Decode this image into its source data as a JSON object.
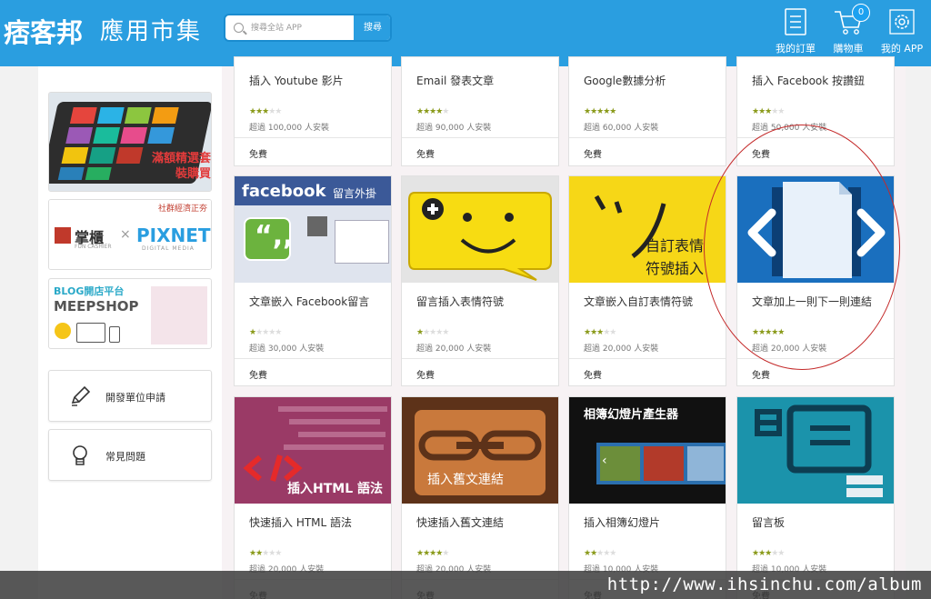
{
  "header": {
    "logo": "痞客邦",
    "title": "應用市集",
    "search": {
      "placeholder": "搜尋全站 APP",
      "button": "搜尋"
    },
    "nav": [
      {
        "label": "我的訂單",
        "icon": "orders-icon"
      },
      {
        "label": "購物車",
        "icon": "cart-icon",
        "badge": "0"
      },
      {
        "label": "我的 APP",
        "icon": "gear-icon"
      }
    ]
  },
  "sidebar": {
    "banners": [
      {
        "name": "app-bundle-banner",
        "text": "滿額精選套裝購買"
      },
      {
        "name": "pixnet-cashier-banner",
        "text_left": "掌櫃",
        "sub_left": "FUN CASHIER",
        "text_right": "PIXNET",
        "sub_right": "DIGITAL MEDIA",
        "corner": "社群經濟正夯"
      },
      {
        "name": "meepshop-banner",
        "line1": "BLOG開店平台",
        "line2": "MEEPSHOP"
      }
    ],
    "links": [
      {
        "label": "開發單位申請",
        "icon": "pencil-icon"
      },
      {
        "label": "常見問題",
        "icon": "lightbulb-icon"
      }
    ]
  },
  "apps": [
    {
      "title": "插入 Youtube 影片",
      "stars": 3,
      "installs": "超過 100,000 人安裝",
      "price": "免費"
    },
    {
      "title": "Email 發表文章",
      "stars": 4,
      "installs": "超過 90,000 人安裝",
      "price": "免費"
    },
    {
      "title": "Google數據分析",
      "stars": 5,
      "installs": "超過 60,000 人安裝",
      "price": "免費"
    },
    {
      "title": "插入 Facebook 按讚鈕",
      "stars": 3,
      "installs": "超過 50,000 人安裝",
      "price": "免費"
    },
    {
      "title": "文章嵌入 Facebook留言",
      "stars": 1,
      "installs": "超過 30,000 人安裝",
      "price": "免費",
      "thumb_text": "facebook",
      "thumb_sub": "留言外掛"
    },
    {
      "title": "留言插入表情符號",
      "stars": 1,
      "installs": "超過 20,000 人安裝",
      "price": "免費"
    },
    {
      "title": "文章嵌入自訂表情符號",
      "stars": 3,
      "installs": "超過 20,000 人安裝",
      "price": "免費",
      "thumb_text": "自訂表情",
      "thumb_sub": "符號插入"
    },
    {
      "title": "文章加上一則下一則連結",
      "stars": 5,
      "installs": "超過 20,000 人安裝",
      "price": "免費"
    },
    {
      "title": "快速插入 HTML 語法",
      "stars": 2,
      "installs": "超過 20,000 人安裝",
      "price": "免費",
      "thumb_text": "插入HTML 語法"
    },
    {
      "title": "快速插入舊文連結",
      "stars": 4,
      "installs": "超過 20,000 人安裝",
      "price": "免費",
      "thumb_text": "插入舊文連結"
    },
    {
      "title": "插入相簿幻燈片",
      "stars": 2,
      "installs": "超過 10,000 人安裝",
      "price": "免費",
      "thumb_text": "相簿幻燈片產生器"
    },
    {
      "title": "留言板",
      "stars": 3,
      "installs": "超過 10,000 人安裝",
      "price": "免費"
    }
  ],
  "watermark": "http://www.ihsinchu.com/album",
  "colors": {
    "header": "#2a9ee0",
    "annotation": "#c42a2a"
  }
}
